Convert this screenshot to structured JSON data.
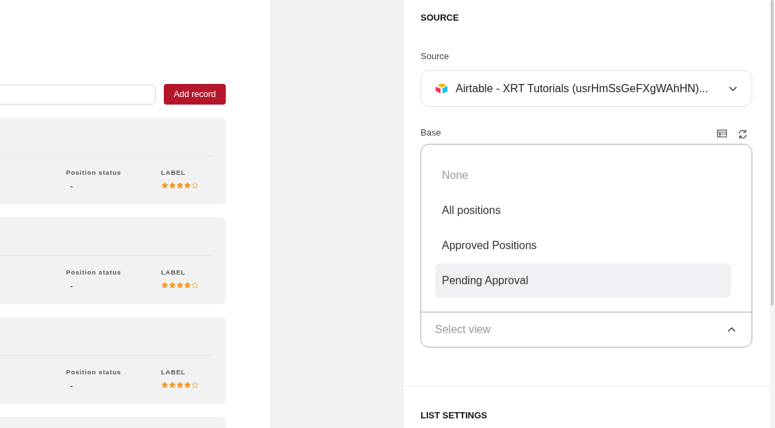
{
  "toolbar": {
    "add_button": "Add record"
  },
  "records": [
    {
      "status_label": "Position status",
      "status_value": "-",
      "rating_label": "LABEL",
      "stars": 4
    },
    {
      "status_label": "Position status",
      "status_value": "-",
      "rating_label": "LABEL",
      "stars": 4
    },
    {
      "status_label": "Position status",
      "status_value": "-",
      "rating_label": "LABEL",
      "stars": 4
    }
  ],
  "panel": {
    "section_title": "SOURCE",
    "source": {
      "label": "Source",
      "value": "Airtable - XRT Tutorials (usrHmSsGeFXgWAhHN)..."
    },
    "base": {
      "label": "Base",
      "expanded": true,
      "options": [
        {
          "label": "None",
          "disabled": true,
          "hovered": false
        },
        {
          "label": "All positions",
          "disabled": false,
          "hovered": false
        },
        {
          "label": "Approved Positions",
          "disabled": false,
          "hovered": false
        },
        {
          "label": "Pending Approval",
          "disabled": false,
          "hovered": true
        }
      ],
      "placeholder": "Select view"
    },
    "next_section_title": "LIST SETTINGS"
  }
}
